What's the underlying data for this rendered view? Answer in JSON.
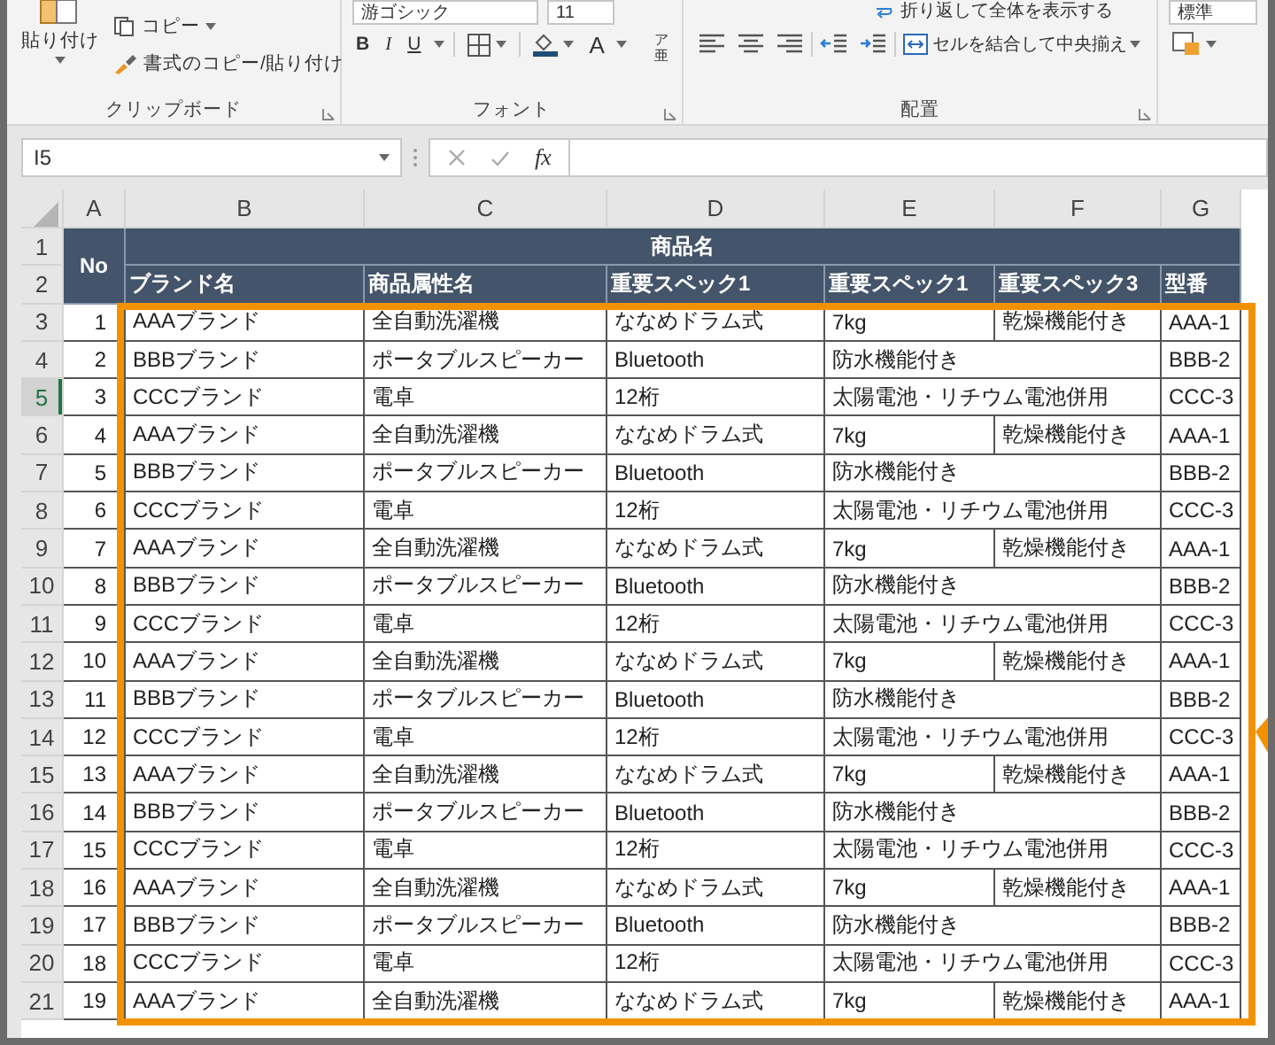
{
  "ribbon": {
    "clipboard": {
      "paste": "貼り付け",
      "copy": "コピー",
      "format_painter": "書式のコピー/貼り付け",
      "label": "クリップボード"
    },
    "font": {
      "font_name": "游ゴシック",
      "font_size": "11",
      "bold": "B",
      "italic": "I",
      "underline": "U",
      "font_color": "A",
      "phonetic_top": "ア",
      "phonetic_bottom": "亜",
      "label": "フォント"
    },
    "alignment": {
      "wrap_text": "折り返して全体を表示する",
      "merge_center": "セルを結合して中央揃え",
      "label": "配置"
    },
    "number": {
      "format": "標準"
    }
  },
  "formula_bar": {
    "name_box": "I5",
    "fx": "fx"
  },
  "sheet": {
    "columns": [
      "A",
      "B",
      "C",
      "D",
      "E",
      "F",
      "G"
    ],
    "header": {
      "row_numbers": [
        "1",
        "2"
      ],
      "no": "No",
      "group": "商品名",
      "fields": [
        "ブランド名",
        "商品属性名",
        "重要スペック1",
        "重要スペック1",
        "重要スペック3",
        "型番"
      ]
    },
    "rows": [
      {
        "row": "3",
        "selected": false,
        "cells": [
          "1",
          "AAAブランド",
          "全自動洗濯機",
          "ななめドラム式",
          "7kg",
          "乾燥機能付き",
          "AAA-1"
        ]
      },
      {
        "row": "4",
        "selected": false,
        "cells": [
          "2",
          "BBBブランド",
          "ポータブルスピーカー",
          "Bluetooth",
          "防水機能付き",
          null,
          "BBB-2"
        ]
      },
      {
        "row": "5",
        "selected": true,
        "cells": [
          "3",
          "CCCブランド",
          "電卓",
          "12桁",
          "太陽電池・リチウム電池併用",
          null,
          "CCC-3"
        ]
      },
      {
        "row": "6",
        "selected": false,
        "cells": [
          "4",
          "AAAブランド",
          "全自動洗濯機",
          "ななめドラム式",
          "7kg",
          "乾燥機能付き",
          "AAA-1"
        ]
      },
      {
        "row": "7",
        "selected": false,
        "cells": [
          "5",
          "BBBブランド",
          "ポータブルスピーカー",
          "Bluetooth",
          "防水機能付き",
          null,
          "BBB-2"
        ]
      },
      {
        "row": "8",
        "selected": false,
        "cells": [
          "6",
          "CCCブランド",
          "電卓",
          "12桁",
          "太陽電池・リチウム電池併用",
          null,
          "CCC-3"
        ]
      },
      {
        "row": "9",
        "selected": false,
        "cells": [
          "7",
          "AAAブランド",
          "全自動洗濯機",
          "ななめドラム式",
          "7kg",
          "乾燥機能付き",
          "AAA-1"
        ]
      },
      {
        "row": "10",
        "selected": false,
        "cells": [
          "8",
          "BBBブランド",
          "ポータブルスピーカー",
          "Bluetooth",
          "防水機能付き",
          null,
          "BBB-2"
        ]
      },
      {
        "row": "11",
        "selected": false,
        "cells": [
          "9",
          "CCCブランド",
          "電卓",
          "12桁",
          "太陽電池・リチウム電池併用",
          null,
          "CCC-3"
        ]
      },
      {
        "row": "12",
        "selected": false,
        "cells": [
          "10",
          "AAAブランド",
          "全自動洗濯機",
          "ななめドラム式",
          "7kg",
          "乾燥機能付き",
          "AAA-1"
        ]
      },
      {
        "row": "13",
        "selected": false,
        "cells": [
          "11",
          "BBBブランド",
          "ポータブルスピーカー",
          "Bluetooth",
          "防水機能付き",
          null,
          "BBB-2"
        ]
      },
      {
        "row": "14",
        "selected": false,
        "cells": [
          "12",
          "CCCブランド",
          "電卓",
          "12桁",
          "太陽電池・リチウム電池併用",
          null,
          "CCC-3"
        ]
      },
      {
        "row": "15",
        "selected": false,
        "cells": [
          "13",
          "AAAブランド",
          "全自動洗濯機",
          "ななめドラム式",
          "7kg",
          "乾燥機能付き",
          "AAA-1"
        ]
      },
      {
        "row": "16",
        "selected": false,
        "cells": [
          "14",
          "BBBブランド",
          "ポータブルスピーカー",
          "Bluetooth",
          "防水機能付き",
          null,
          "BBB-2"
        ]
      },
      {
        "row": "17",
        "selected": false,
        "cells": [
          "15",
          "CCCブランド",
          "電卓",
          "12桁",
          "太陽電池・リチウム電池併用",
          null,
          "CCC-3"
        ]
      },
      {
        "row": "18",
        "selected": false,
        "cells": [
          "16",
          "AAAブランド",
          "全自動洗濯機",
          "ななめドラム式",
          "7kg",
          "乾燥機能付き",
          "AAA-1"
        ]
      },
      {
        "row": "19",
        "selected": false,
        "cells": [
          "17",
          "BBBブランド",
          "ポータブルスピーカー",
          "Bluetooth",
          "防水機能付き",
          null,
          "BBB-2"
        ]
      },
      {
        "row": "20",
        "selected": false,
        "cells": [
          "18",
          "CCCブランド",
          "電卓",
          "12桁",
          "太陽電池・リチウム電池併用",
          null,
          "CCC-3"
        ]
      },
      {
        "row": "21",
        "selected": false,
        "cells": [
          "19",
          "AAAブランド",
          "全自動洗濯機",
          "ななめドラム式",
          "7kg",
          "乾燥機能付き",
          "AAA-1"
        ]
      }
    ]
  }
}
